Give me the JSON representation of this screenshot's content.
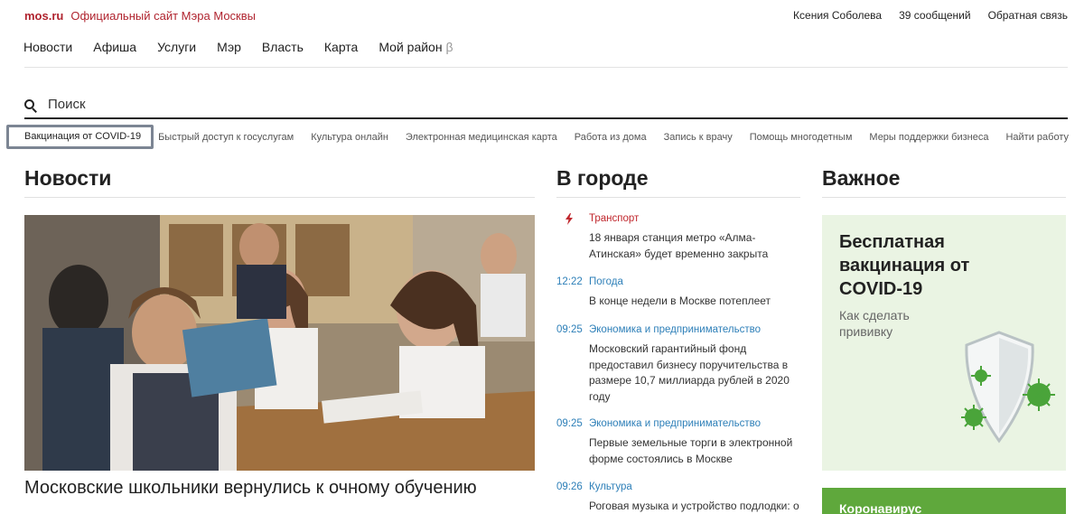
{
  "top": {
    "logo": "mos.ru",
    "site_title": "Официальный сайт Мэра Москвы",
    "user_name": "Ксения Соболева",
    "messages": "39 сообщений",
    "feedback": "Обратная связь"
  },
  "nav": {
    "items": [
      "Новости",
      "Афиша",
      "Услуги",
      "Мэр",
      "Власть",
      "Карта"
    ],
    "district": "Мой район",
    "district_badge": "β"
  },
  "search": {
    "placeholder": "Поиск",
    "value": ""
  },
  "quick_links": [
    "Вакцинация от COVID-19",
    "Быстрый доступ к госуслугам",
    "Культура онлайн",
    "Электронная медицинская карта",
    "Работа из дома",
    "Запись к врачу",
    "Помощь многодетным",
    "Меры поддержки бизнеса",
    "Найти работу"
  ],
  "news": {
    "heading": "Новости",
    "lead_caption": "Московские школьники вернулись к очному обучению"
  },
  "city": {
    "heading": "В городе",
    "items": [
      {
        "time": "",
        "category": "Транспорт",
        "text": "18 января станция метро «Алма-Атинская» будет временно закрыта"
      },
      {
        "time": "12:22",
        "category": "Погода",
        "text": "В конце недели в Москве потеплеет"
      },
      {
        "time": "09:25",
        "category": "Экономика и предпринимательство",
        "text": "Московский гарантийный фонд предоставил бизнесу поручительства в размере 10,7 миллиарда рублей в 2020 году"
      },
      {
        "time": "09:25",
        "category": "Экономика и предпринимательство",
        "text": "Первые земельные торги в электронной форме состоялись в Москве"
      },
      {
        "time": "09:26",
        "category": "Культура",
        "text": "Роговая музыка и устройство подлодки: о"
      }
    ]
  },
  "important": {
    "heading": "Важное",
    "card_title": "Бесплатная вакцинация от COVID-19",
    "card_sub": "Как сделать прививку",
    "card2_title": "Коронавирус"
  },
  "colors": {
    "brand_red": "#b0242f",
    "link_blue": "#2d7fb8",
    "card_green": "#eaf4e3",
    "banner_green": "#5fa83c"
  }
}
